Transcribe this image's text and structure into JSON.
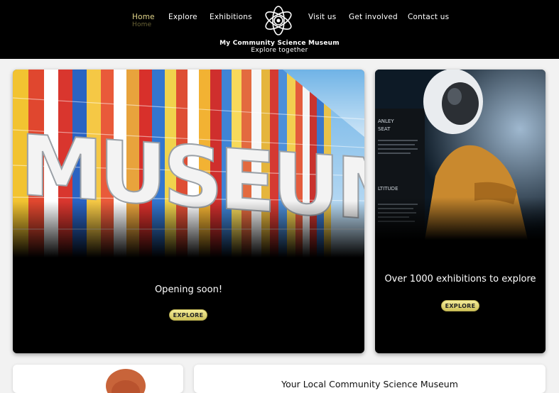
{
  "nav": {
    "left": [
      {
        "label": "Home",
        "active": true
      },
      {
        "label": "Explore"
      },
      {
        "label": "Exhibitions"
      }
    ],
    "right": [
      {
        "label": "Visit us"
      },
      {
        "label": "Get involved"
      },
      {
        "label": "Contact us"
      }
    ],
    "active_shadow": "Home"
  },
  "site": {
    "title": "My Community Science Museum",
    "tagline": "Explore together",
    "logo_icon": "atom-icon"
  },
  "cards": [
    {
      "title": "Opening soon!",
      "button": "EXPLORE",
      "image": "colorful museum sign photo"
    },
    {
      "title": "Over 1000 exhibitions to explore",
      "button": "EXPLORE",
      "image": "astronaut exhibit photo"
    }
  ],
  "lower": {
    "title": "Your Local Community Science Museum"
  },
  "colors": {
    "header_bg": "#000000",
    "accent": "#e2d58a",
    "button": "#e6dc78"
  }
}
